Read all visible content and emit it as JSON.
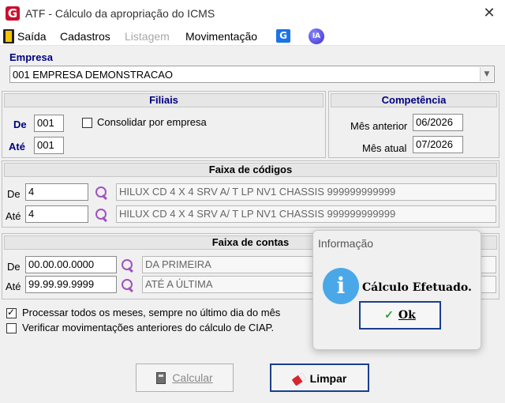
{
  "window": {
    "title": "ATF - Cálculo da apropriação do ICMS",
    "close_label": "✕"
  },
  "menu": {
    "items": [
      "Saída",
      "Cadastros",
      "Listagem",
      "Movimentação"
    ],
    "g_label": "G",
    "ia_label": "IA"
  },
  "empresa": {
    "label": "Empresa",
    "value": "001 EMPRESA DEMONSTRACAO"
  },
  "filiais": {
    "title": "Filiais",
    "de_label": "De",
    "de_value": "001",
    "ate_label": "Até",
    "ate_value": "001",
    "consolidar_label": "Consolidar por empresa",
    "consolidar_checked": false
  },
  "competencia": {
    "title": "Competência",
    "mes_anterior_label": "Mês anterior",
    "mes_anterior_value": "06/2026",
    "mes_atual_label": "Mês atual",
    "mes_atual_value": "07/2026"
  },
  "faixa_codigos": {
    "title": "Faixa de códigos",
    "de_label": "De",
    "de_value": "4",
    "de_desc": "HILUX CD 4 X 4 SRV A/ T LP NV1 CHASSIS 999999999999",
    "ate_label": "Até",
    "ate_value": "4",
    "ate_desc": "HILUX CD 4 X 4 SRV A/ T LP NV1 CHASSIS 999999999999"
  },
  "faixa_contas": {
    "title": "Faixa de contas",
    "de_label": "De",
    "de_value": "00.00.00.0000",
    "de_desc": "DA PRIMEIRA",
    "ate_label": "Até",
    "ate_value": "99.99.99.9999",
    "ate_desc": "ATÉ A ÚLTIMA"
  },
  "options": [
    {
      "label": "Processar todos os meses, sempre no último dia do mês",
      "checked": true
    },
    {
      "label": "Verificar movimentações anteriores do cálculo de CIAP.",
      "checked": false
    }
  ],
  "buttons": {
    "calcular": "Calcular",
    "limpar": "Limpar"
  },
  "dialog": {
    "title": "Informação",
    "message": "Cálculo Efetuado.",
    "ok_label": "Ok"
  },
  "colors": {
    "header_blue": "#000080",
    "info_blue": "#4aa8e8",
    "focus_border": "#1b3f8f",
    "brand_red": "#c8102e"
  }
}
